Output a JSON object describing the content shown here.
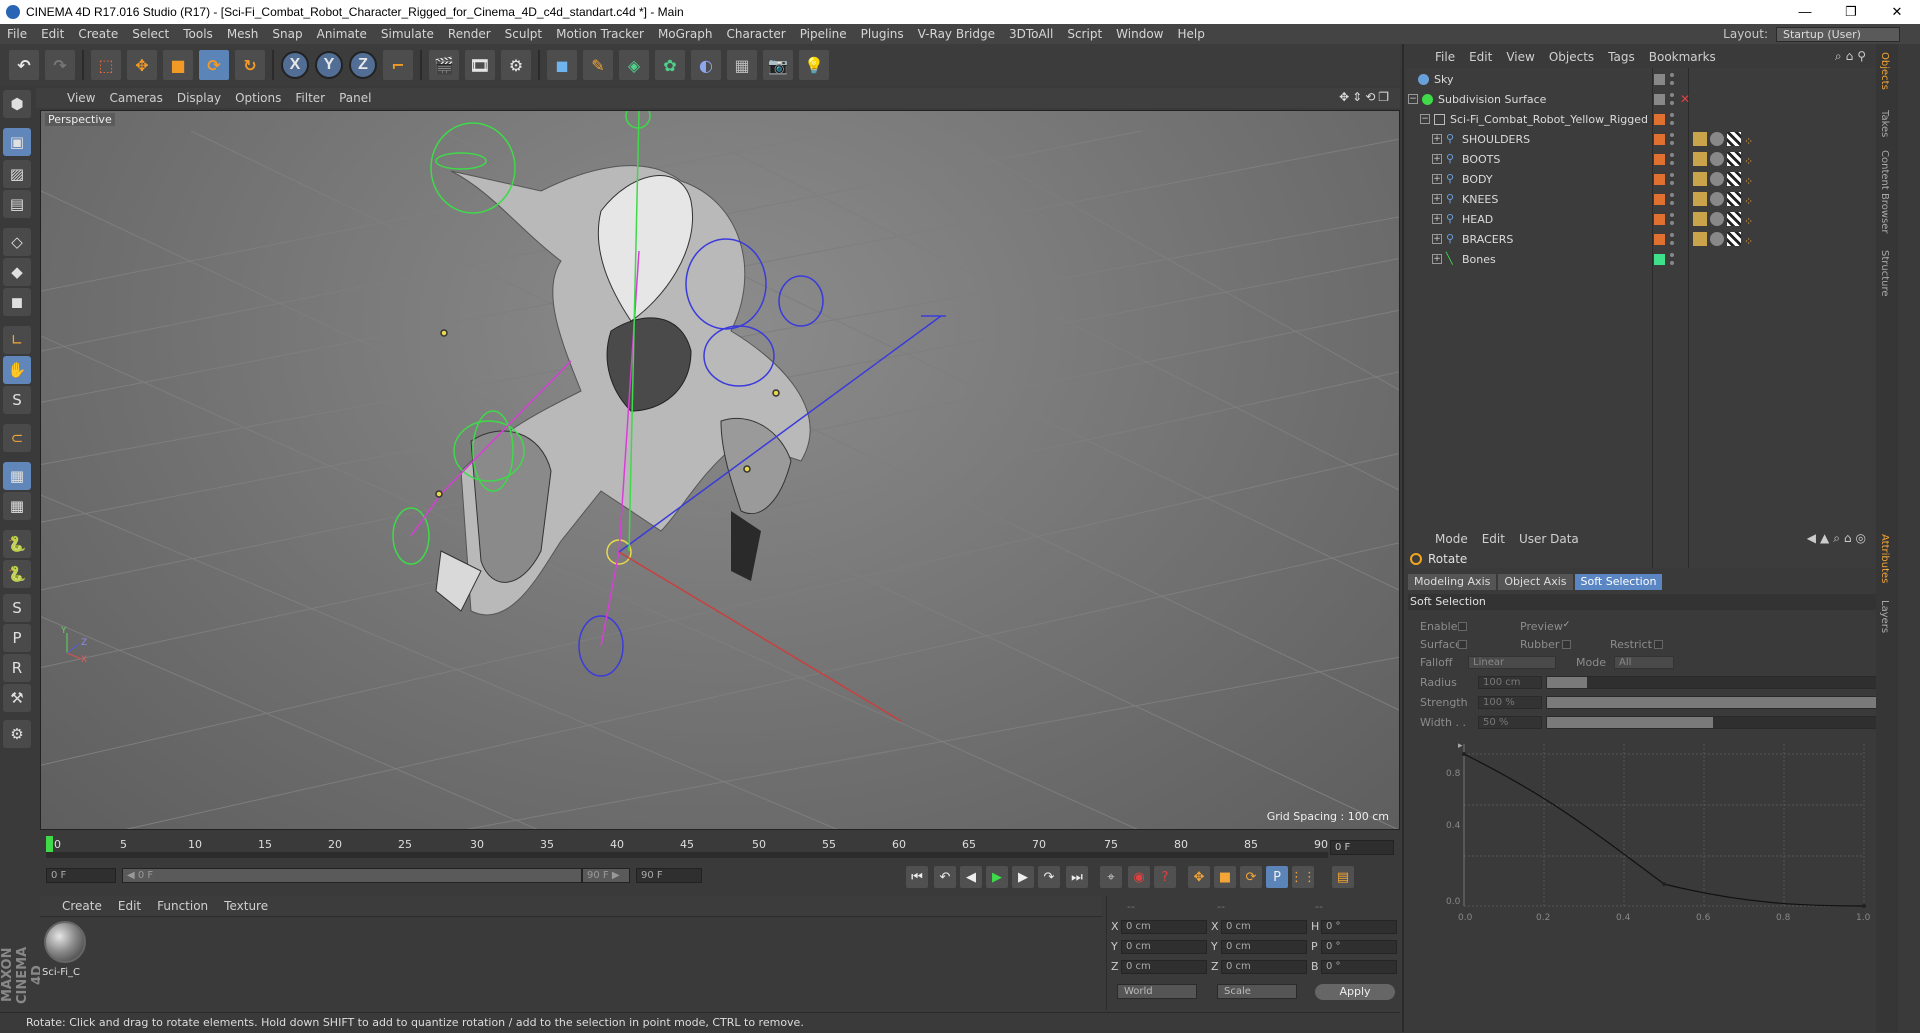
{
  "window": {
    "title": "CINEMA 4D R17.016 Studio (R17) - [Sci-Fi_Combat_Robot_Character_Rigged_for_Cinema_4D_c4d_standart.c4d *] - Main",
    "minimize": "—",
    "maximize": "❐",
    "close": "✕"
  },
  "menubar": {
    "items": [
      "File",
      "Edit",
      "Create",
      "Select",
      "Tools",
      "Mesh",
      "Snap",
      "Animate",
      "Simulate",
      "Render",
      "Sculpt",
      "Motion Tracker",
      "MoGraph",
      "Character",
      "Pipeline",
      "Plugins",
      "V-Ray Bridge",
      "3DToAll",
      "Script",
      "Window",
      "Help"
    ],
    "layout_label": "Layout:",
    "layout_value": "Startup (User)"
  },
  "toolbar": {
    "x_label": "X",
    "y_label": "Y",
    "z_label": "Z"
  },
  "viewport": {
    "menu": [
      "View",
      "Cameras",
      "Display",
      "Options",
      "Filter",
      "Panel"
    ],
    "label": "Perspective",
    "grid_spacing": "Grid Spacing : 100 cm",
    "nav_icons": "✥⇕⟲❐"
  },
  "timeline": {
    "ticks": [
      "0",
      "5",
      "10",
      "15",
      "20",
      "25",
      "30",
      "35",
      "40",
      "45",
      "50",
      "55",
      "60",
      "65",
      "70",
      "75",
      "80",
      "85",
      "90"
    ],
    "current_frame": "0 F",
    "start_field": "0 F",
    "range_start": "◀ 0 F",
    "range_end": "90 F ▶",
    "end_field": "90 F"
  },
  "material_manager": {
    "menu": [
      "Create",
      "Edit",
      "Function",
      "Texture"
    ],
    "material_name": "Sci-Fi_C"
  },
  "branding": {
    "logo": "MAXON CINEMA 4D"
  },
  "coordinates": {
    "header": [
      "--",
      "--",
      "--"
    ],
    "rows": [
      {
        "axis": "X",
        "pos": "0 cm",
        "size_axis": "X",
        "size": "0 cm",
        "rot_axis": "H",
        "rot": "0 °"
      },
      {
        "axis": "Y",
        "pos": "0 cm",
        "size_axis": "Y",
        "size": "0 cm",
        "rot_axis": "P",
        "rot": "0 °"
      },
      {
        "axis": "Z",
        "pos": "0 cm",
        "size_axis": "Z",
        "size": "0 cm",
        "rot_axis": "B",
        "rot": "0 °"
      }
    ],
    "space": "World",
    "mode": "Scale",
    "apply": "Apply"
  },
  "status": "Rotate: Click and drag to rotate elements. Hold down SHIFT to add to quantize rotation / add to the selection in point mode, CTRL to remove.",
  "object_manager": {
    "menu": [
      "File",
      "Edit",
      "View",
      "Objects",
      "Tags",
      "Bookmarks"
    ],
    "objects": [
      {
        "name": "Sky"
      },
      {
        "name": "Subdivision Surface"
      },
      {
        "name": "Sci-Fi_Combat_Robot_Yellow_Rigged"
      },
      {
        "name": "SHOULDERS"
      },
      {
        "name": "BOOTS"
      },
      {
        "name": "BODY"
      },
      {
        "name": "KNEES"
      },
      {
        "name": "HEAD"
      },
      {
        "name": "BRACERS"
      },
      {
        "name": "Bones"
      }
    ],
    "side_tabs": [
      "Objects",
      "Takes",
      "Content Browser",
      "Structure"
    ]
  },
  "attributes": {
    "menu": [
      "Mode",
      "Edit",
      "User Data"
    ],
    "title": "Rotate",
    "tabs": [
      "Modeling Axis",
      "Object Axis",
      "Soft Selection"
    ],
    "active_tab": "Soft Selection",
    "section": "Soft Selection",
    "enable": "Enable",
    "preview": "Preview",
    "preview_check": "✓",
    "surface": "Surface",
    "rubber": "Rubber",
    "restrict": "Restrict",
    "falloff": "Falloff",
    "falloff_value": "Linear",
    "mode": "Mode",
    "mode_value": "All",
    "radius": "Radius",
    "radius_value": "100 cm",
    "radius_fraction": 0.12,
    "strength": "Strength",
    "strength_value": "100 %",
    "strength_fraction": 1.0,
    "width": "Width . .",
    "width_value": "50 %",
    "width_fraction": 0.5,
    "side_tabs": [
      "Attributes",
      "Layers"
    ]
  },
  "falloff_graph": {
    "y_ticks": [
      "0.8",
      "0.4",
      "0.0"
    ],
    "x_ticks": [
      "0.2",
      "0.4",
      "0.6",
      "0.8",
      "1.0"
    ],
    "x0_label": "0.0"
  }
}
